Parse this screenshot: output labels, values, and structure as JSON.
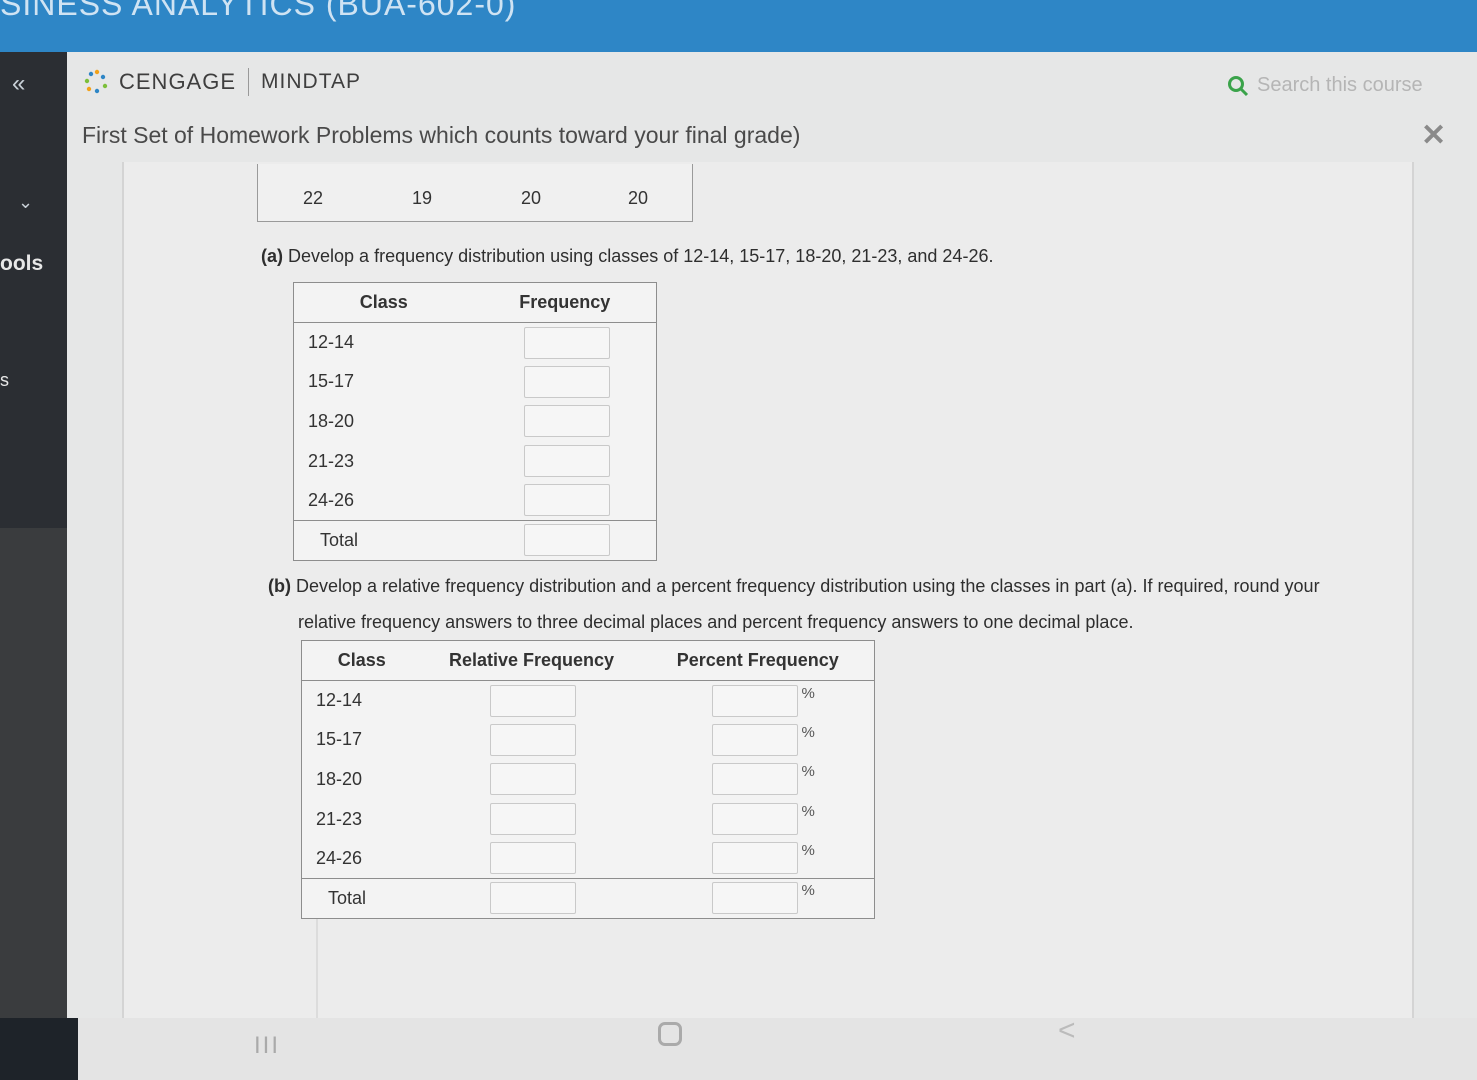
{
  "browser": {
    "course_title": "SINESS ANALYTICS (BUA-602-0)"
  },
  "sidebar": {
    "collapse_icon": "«",
    "chevron_icon": "⌄",
    "tools_label": "ools",
    "partial_label": "s"
  },
  "header": {
    "brand": "CENGAGE",
    "product": "MINDTAP",
    "search_placeholder": "Search this course",
    "page_title": "First Set of Homework Problems which counts toward your final grade)",
    "close_icon": "✕"
  },
  "data_table": {
    "values": [
      "22",
      "19",
      "20",
      "20"
    ]
  },
  "part_a": {
    "label": "(a)",
    "question": "Develop a frequency distribution using classes of 12-14, 15-17, 18-20, 21-23, and 24-26.",
    "columns": [
      "Class",
      "Frequency"
    ],
    "classes": [
      "12-14",
      "15-17",
      "18-20",
      "21-23",
      "24-26"
    ],
    "total_label": "Total"
  },
  "part_b": {
    "label": "(b)",
    "question_line1": "Develop a relative frequency distribution and a percent frequency distribution using the classes in part (a). If required, round your",
    "question_line2": "relative frequency answers to three decimal places and percent frequency answers to one decimal place.",
    "columns": [
      "Class",
      "Relative Frequency",
      "Percent Frequency"
    ],
    "classes": [
      "12-14",
      "15-17",
      "18-20",
      "21-23",
      "24-26"
    ],
    "total_label": "Total",
    "percent_sign": "%"
  },
  "device_nav": {
    "recent_icon": "III",
    "back_icon": "<"
  },
  "colors": {
    "topbar": "#2e86c6",
    "page_bg": "#e6e7e7",
    "cengage_dots": [
      "#2e86c6",
      "#f2a21a",
      "#7cbf3a"
    ]
  }
}
